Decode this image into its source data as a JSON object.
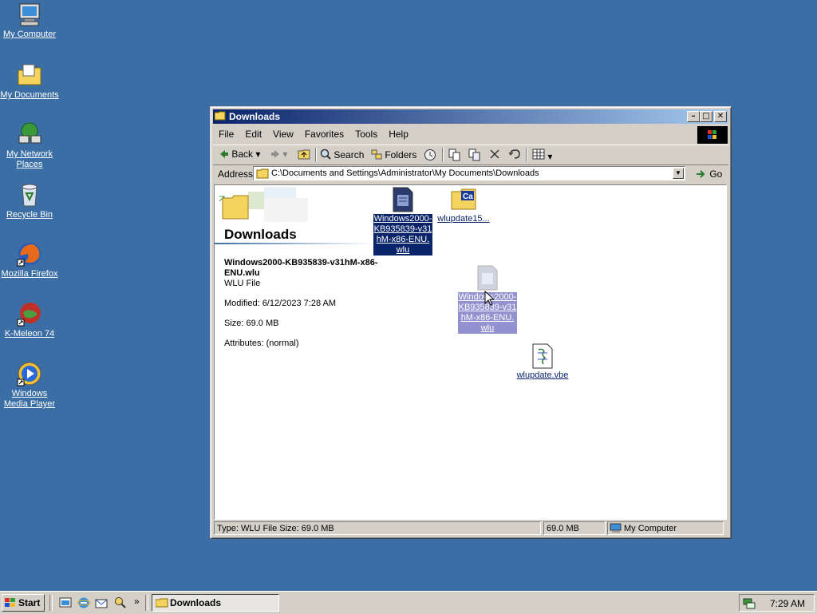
{
  "desktop": {
    "icons": [
      {
        "label": "My Computer",
        "icon": "computer-icon"
      },
      {
        "label": "My Documents",
        "icon": "documents-folder-icon"
      },
      {
        "label": "My Network Places",
        "icon": "network-icon"
      },
      {
        "label": "Recycle Bin",
        "icon": "recycle-bin-icon"
      },
      {
        "label": "Mozilla Firefox",
        "icon": "firefox-icon"
      },
      {
        "label": "K-Meleon 74",
        "icon": "kmeleon-icon"
      },
      {
        "label": "Windows Media Player",
        "icon": "media-player-icon"
      }
    ]
  },
  "window": {
    "title": "Downloads",
    "menu": [
      "File",
      "Edit",
      "View",
      "Favorites",
      "Tools",
      "Help"
    ],
    "toolbar": {
      "back": "Back",
      "search": "Search",
      "folders": "Folders"
    },
    "address": {
      "label": "Address",
      "value": "C:\\Documents and Settings\\Administrator\\My Documents\\Downloads",
      "go": "Go"
    },
    "panel": {
      "folder_title": "Downloads",
      "selected_name": "Windows2000-KB935839-v31hM-x86-ENU.wlu",
      "selected_type": "WLU File",
      "modified": "Modified: 6/12/2023 7:28 AM",
      "size": "Size: 69.0 MB",
      "attributes": "Attributes: (normal)"
    },
    "files": [
      {
        "label": "Windows2000-KB935839-v31hM-x86-ENU.wlu",
        "icon": "wlu-file-icon",
        "state": "selected"
      },
      {
        "label": "wlupdate15...",
        "icon": "folder-ca-icon",
        "state": "normal"
      },
      {
        "label": "Windows2000-KB935839-v31hM-x86-ENU.wlu",
        "icon": "wlu-file-icon",
        "state": "dragging"
      },
      {
        "label": "wlupdate.vbe",
        "icon": "script-file-icon",
        "state": "normal"
      }
    ],
    "status": {
      "info": "Type: WLU File Size: 69.0 MB",
      "size": "69.0 MB",
      "zone": "My Computer"
    }
  },
  "taskbar": {
    "start": "Start",
    "quicklaunch": [
      "show-desktop-icon",
      "internet-explorer-icon",
      "outlook-express-icon",
      "search-icon"
    ],
    "task": "Downloads",
    "clock": "7:29 AM"
  },
  "colors": {
    "desktop": "#3a6ea5",
    "titlebar_start": "#0a246a",
    "titlebar_end": "#a6caf0",
    "selection": "#0a246a",
    "face": "#d4d0c8"
  }
}
